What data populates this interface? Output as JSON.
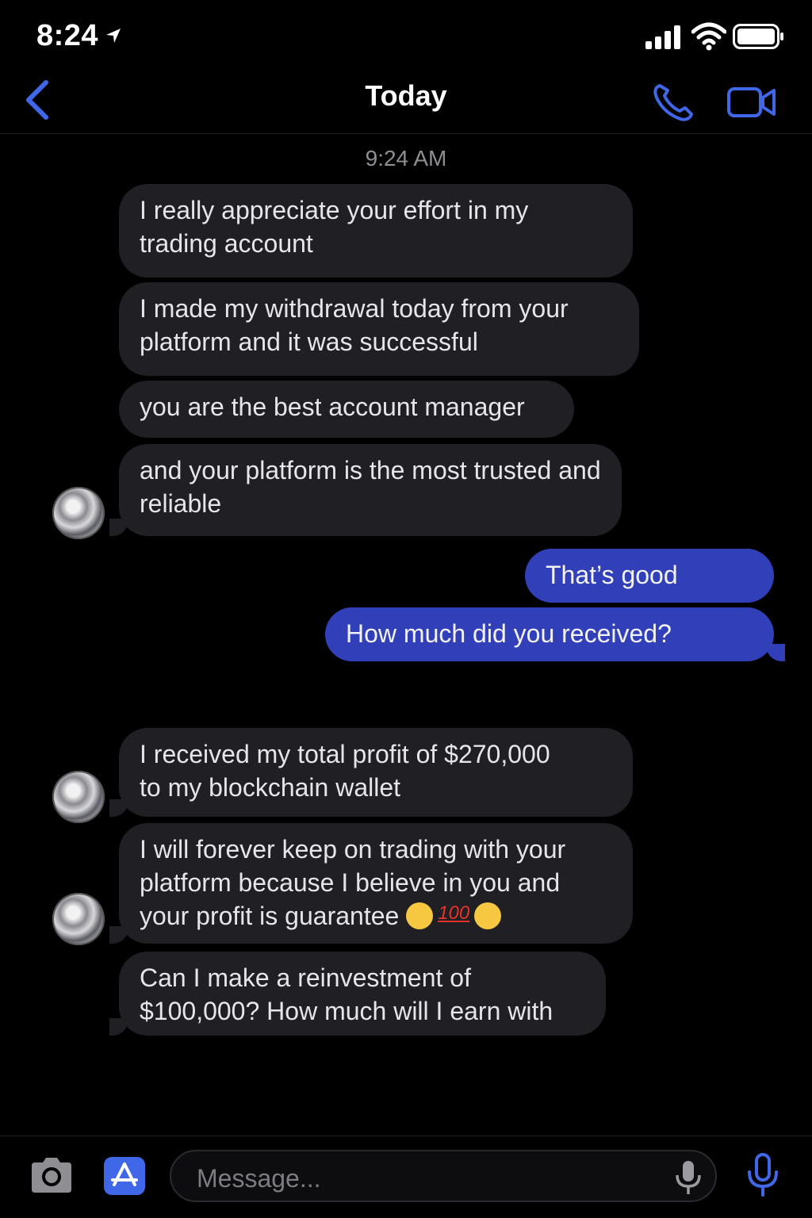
{
  "status_bar": {
    "time": "8:24"
  },
  "nav": {
    "title": "Today"
  },
  "thread": {
    "timestamp": "9:24 AM",
    "messages": [
      {
        "from": "them",
        "text": "I really appreciate your effort in my trading account"
      },
      {
        "from": "them",
        "text": "I made my withdrawal today from your platform and it was successful"
      },
      {
        "from": "them",
        "text": "you are the best account manager"
      },
      {
        "from": "them",
        "text": "and your platform is the most trusted and reliable"
      },
      {
        "from": "me",
        "text": "That’s good"
      },
      {
        "from": "me",
        "text": "How much did you received?"
      },
      {
        "from": "them",
        "text": "I received my total profit of $270,000 to my blockchain wallet"
      },
      {
        "from": "them",
        "text": "I will forever keep on trading with your platform because I believe in you and your profit is guarantee",
        "emojis": [
          "smiling-face",
          "hundred-points",
          "smiling-face"
        ],
        "hundred_label": "100"
      },
      {
        "from": "them",
        "text": "Can I make a reinvestment of $100,000? How much will I earn with"
      }
    ]
  },
  "composer": {
    "placeholder": "Message..."
  },
  "colors": {
    "outgoing_bubble": "#3140b8",
    "incoming_bubble": "#1f1f24",
    "accent": "#3f67e8",
    "background": "#000000"
  }
}
